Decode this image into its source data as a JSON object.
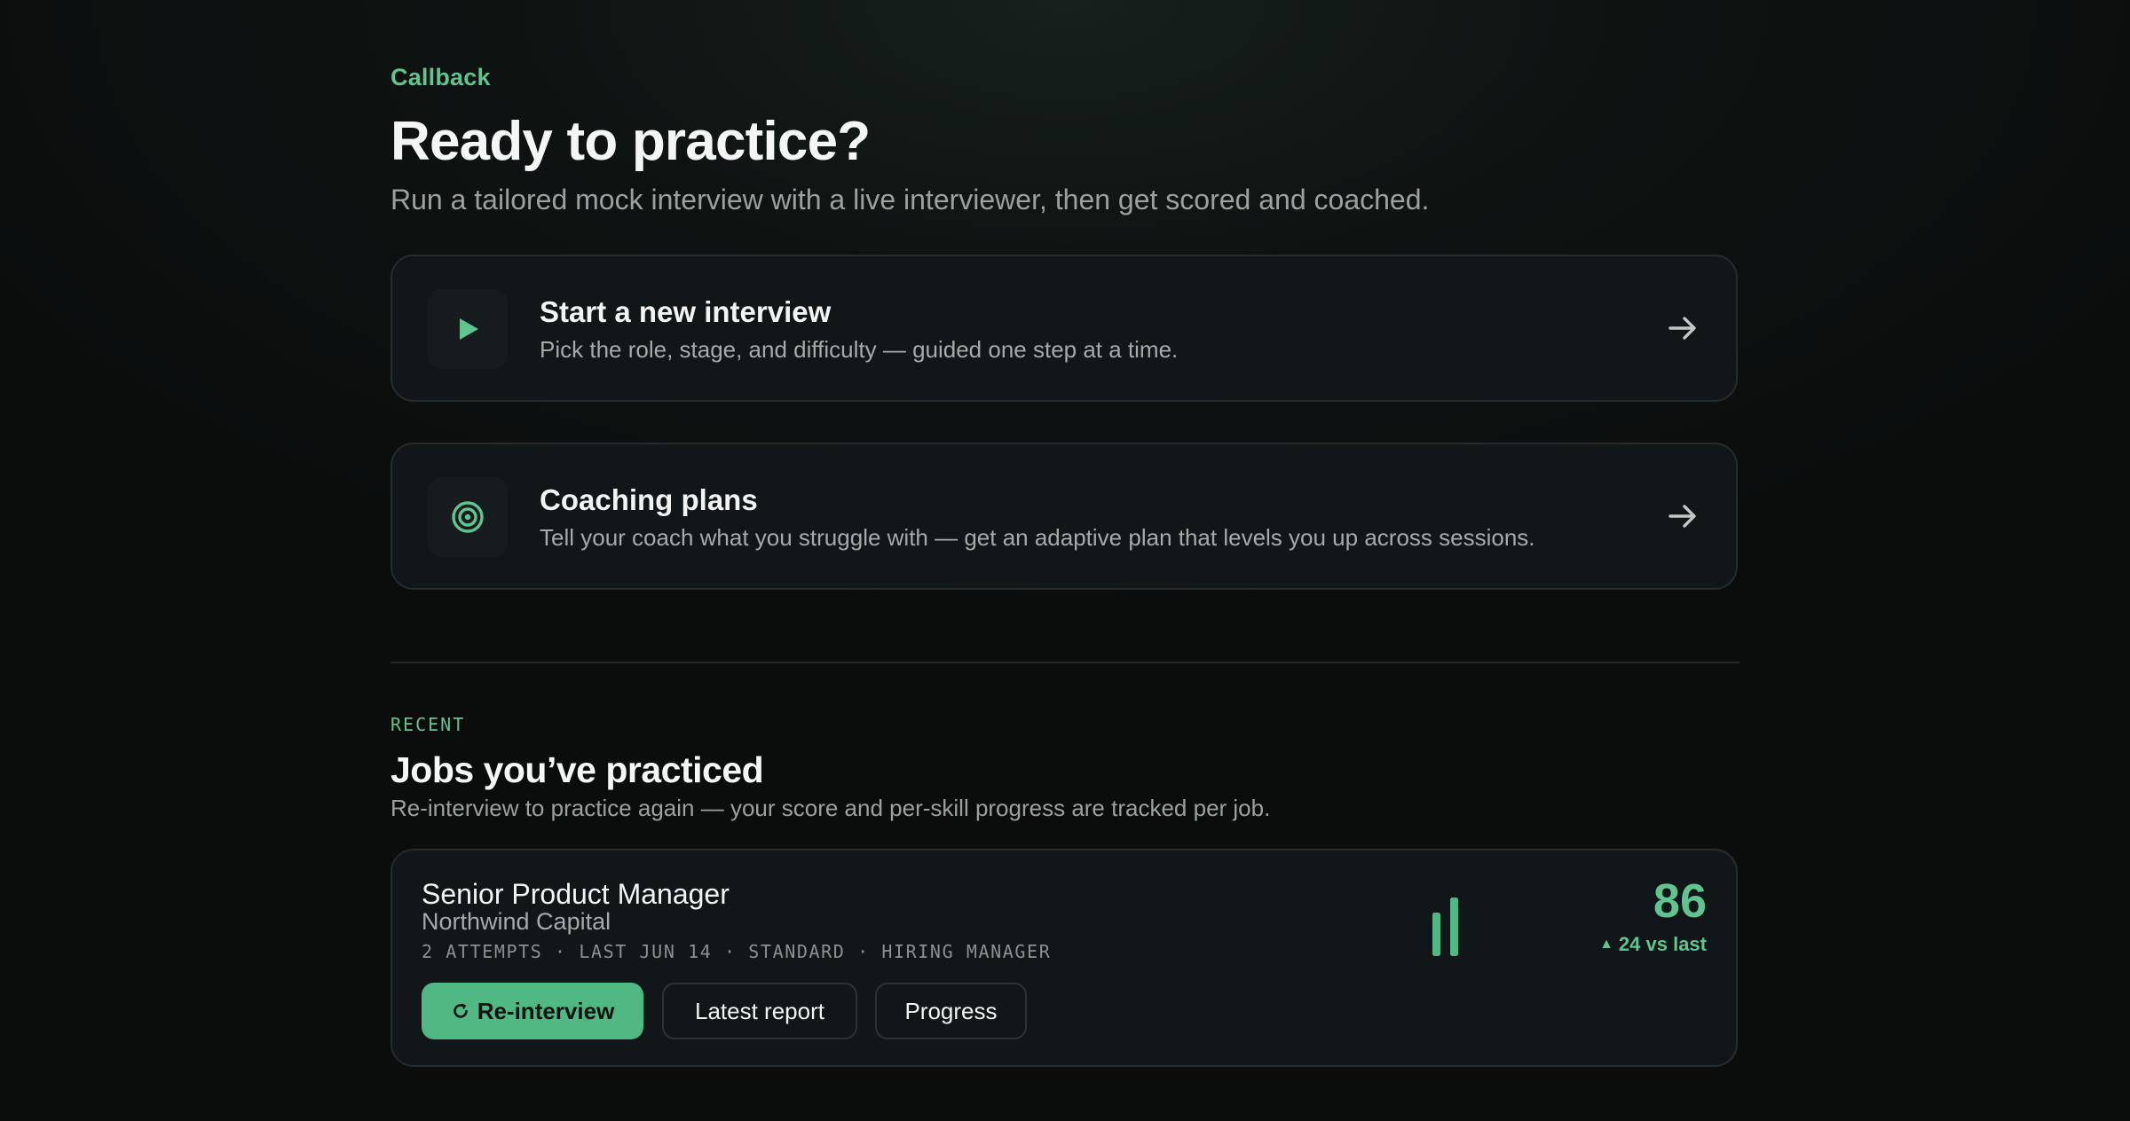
{
  "brand": "Callback",
  "hero": {
    "title": "Ready to practice?",
    "subtitle": "Run a tailored mock interview with a live interviewer, then get scored and coached."
  },
  "actions": [
    {
      "title": "Start a new interview",
      "description": "Pick the role, stage, and difficulty — guided one step at a time.",
      "icon": "play-icon"
    },
    {
      "title": "Coaching plans",
      "description": "Tell your coach what you struggle with — get an adaptive plan that levels you up across sessions.",
      "icon": "target-icon"
    }
  ],
  "recent": {
    "eyebrow": "RECENT",
    "title": "Jobs you’ve practiced",
    "subtitle": "Re-interview to practice again — your score and per-skill progress are tracked per job.",
    "jobs": [
      {
        "title": "Senior Product Manager",
        "company": "Northwind Capital",
        "meta": "2 ATTEMPTS · LAST JUN 14 · STANDARD · HIRING MANAGER",
        "score": "86",
        "delta": "24 vs last",
        "buttons": {
          "reinterview": "Re-interview",
          "report": "Latest report",
          "progress": "Progress"
        }
      }
    ]
  },
  "colors": {
    "accent": "#5fc48e",
    "button_primary": "#4fb883",
    "background": "#0b0d0d",
    "card": "#111618"
  }
}
